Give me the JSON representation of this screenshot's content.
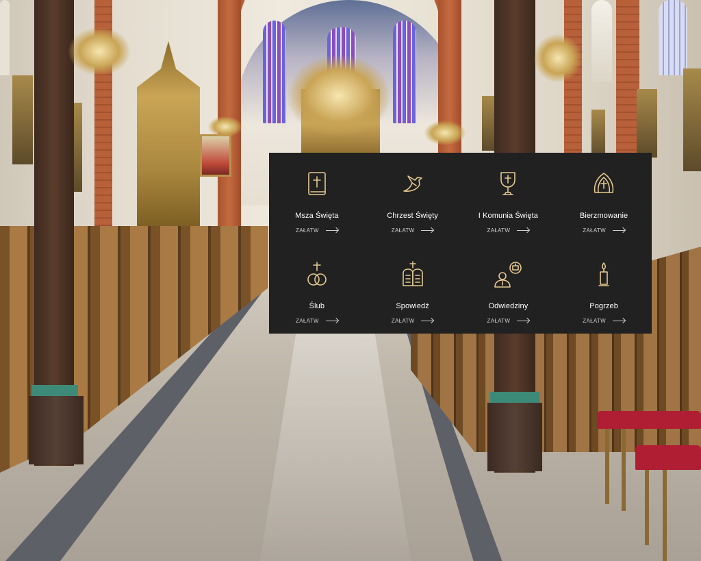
{
  "panel": {
    "accent_color": "#e6c98f",
    "background_color": "#212121",
    "services": [
      {
        "label": "Msza Święta",
        "cta": "ZAŁATW",
        "icon": "bible-icon"
      },
      {
        "label": "Chrzest Święty",
        "cta": "ZAŁATW",
        "icon": "dove-icon"
      },
      {
        "label": "I Komunia Święta",
        "cta": "ZAŁATW",
        "icon": "chalice-icon"
      },
      {
        "label": "Bierzmowanie",
        "cta": "ZAŁATW",
        "icon": "mitre-icon"
      },
      {
        "label": "Ślub",
        "cta": "ZAŁATW",
        "icon": "wedding-rings-icon"
      },
      {
        "label": "Spowiedź",
        "cta": "ZAŁATW",
        "icon": "commandments-tablets-icon"
      },
      {
        "label": "Odwiedziny",
        "cta": "ZAŁATW",
        "icon": "priest-visit-icon"
      },
      {
        "label": "Pogrzeb",
        "cta": "ZAŁATW",
        "icon": "candle-icon"
      }
    ]
  }
}
